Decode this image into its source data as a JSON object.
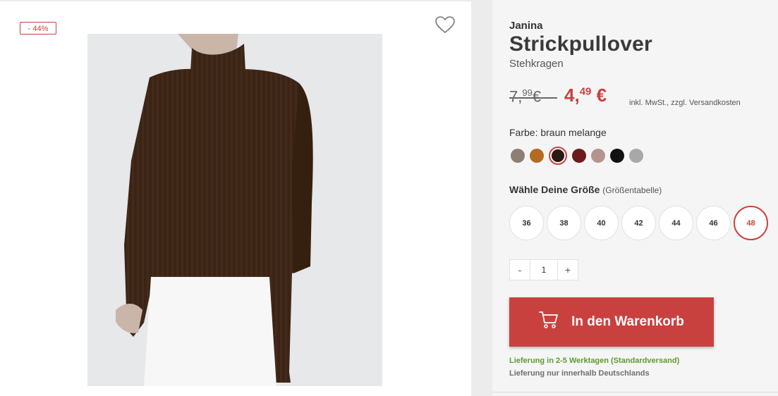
{
  "badge": {
    "discount": "- 44%"
  },
  "product": {
    "brand": "Janina",
    "title": "Strickpullover",
    "subtitle": "Stehkragen",
    "old_price_main": "7,",
    "old_price_cents": "99",
    "old_price_currency": "€",
    "new_price_main": "4,",
    "new_price_cents": "49",
    "new_price_currency": "€",
    "tax_note": "inkl. MwSt., zzgl. Versandkosten",
    "image_icon": "product-photo"
  },
  "colors": {
    "label": "Farbe: braun melange",
    "swatches": [
      "#8d7f74",
      "#b36a21",
      "#2a1a14",
      "#6b1b1d",
      "#b59490",
      "#111111",
      "#a8a8a8"
    ],
    "selected_index": 2
  },
  "sizes": {
    "label": "Wähle Deine Größe",
    "chart_link": "(Größentabelle)",
    "options": [
      "36",
      "38",
      "40",
      "42",
      "44",
      "46",
      "48"
    ],
    "selected": "48"
  },
  "quantity": {
    "minus": "-",
    "value": "1",
    "plus": "+"
  },
  "cart": {
    "button_label": "In den Warenkorb",
    "icon": "cart-icon"
  },
  "delivery": {
    "time": "Lieferung in 2-5 Werktagen (Standardversand)",
    "note": "Lieferung nur innerhalb Deutschlands"
  },
  "wishlist_icon": "heart-icon",
  "theme": {
    "accent": "#c9413f",
    "success": "#5b9b2e"
  }
}
